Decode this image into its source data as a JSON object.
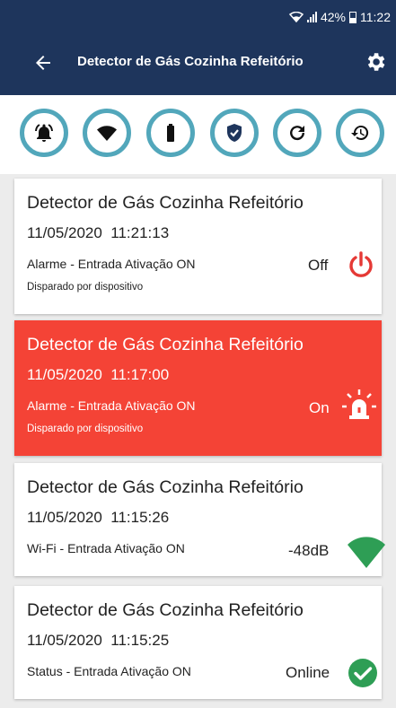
{
  "status_bar": {
    "battery": "42%",
    "time": "11:22"
  },
  "app_bar": {
    "title": "Detector de Gás Cozinha Refeitório"
  },
  "toolbar": {
    "icons": [
      "bell-ring-icon",
      "wifi-icon",
      "battery-icon",
      "shield-check-icon",
      "refresh-icon",
      "history-icon"
    ],
    "accent": "#52a7bb"
  },
  "colors": {
    "primary": "#1e355c",
    "alarm": "#f44336",
    "green": "#2e9e55",
    "power_off": "#e53935"
  },
  "events": [
    {
      "device": "Detector de Gás Cozinha Refeitório",
      "date": "11/05/2020",
      "time": "11:21:13",
      "type": "Alarme",
      "description": " - Entrada Ativação ON",
      "source": "Disparado por dispositivo",
      "value": "Off",
      "icon": "power-icon"
    },
    {
      "device": "Detector de Gás Cozinha Refeitório",
      "date": "11/05/2020",
      "time": "11:17:00",
      "type": "Alarme",
      "description": " - Entrada Ativação ON",
      "source": "Disparado por dispositivo",
      "value": "On",
      "icon": "siren-icon"
    },
    {
      "device": "Detector de Gás Cozinha Refeitório",
      "date": "11/05/2020",
      "time": "11:15:26",
      "type": "Wi-Fi",
      "description": " - Entrada Ativação ON",
      "value": "-48dB",
      "icon": "wifi-signal-icon"
    },
    {
      "device": "Detector de Gás Cozinha Refeitório",
      "date": "11/05/2020",
      "time": "11:15:25",
      "type": "Status",
      "description": " - Entrada Ativação ON",
      "value": "Online",
      "icon": "check-circle-icon"
    }
  ]
}
